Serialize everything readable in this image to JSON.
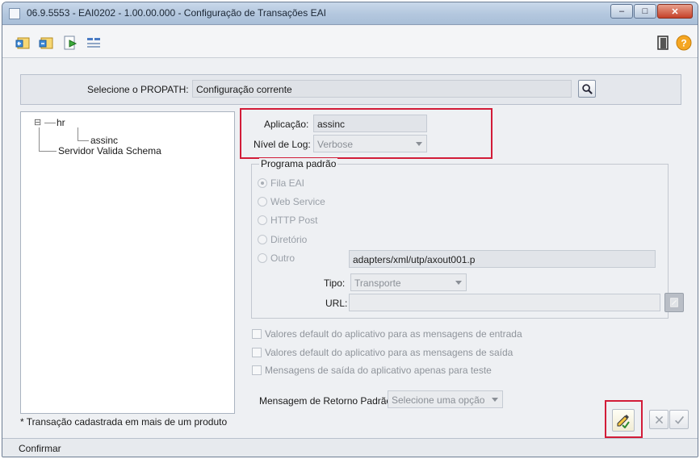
{
  "window": {
    "title": "06.9.5553 - EAI0202 - 1.00.00.000 - Configuração de Transações EAI",
    "controls": {
      "minimize": "–",
      "maximize": "□",
      "close": "✕"
    }
  },
  "toolbar": {
    "icons": [
      "first-record-icon",
      "previous-record-icon",
      "go-to-record-icon",
      "list-icon",
      "exit-door-icon",
      "help-icon"
    ]
  },
  "propath": {
    "label": "Selecione o PROPATH:",
    "value": "Configuração corrente"
  },
  "tree": {
    "nodes": [
      {
        "label": "hr",
        "expander": "⊟"
      },
      {
        "label": "assinc"
      },
      {
        "label": "Servidor Valida Schema"
      }
    ]
  },
  "form": {
    "aplicacao_label": "Aplicação:",
    "aplicacao_value": "assinc",
    "nivel_log_label": "Nível de Log:",
    "nivel_log_value": "Verbose",
    "programa_group_title": "Programa padrão",
    "radios": [
      {
        "label": "Fila EAI",
        "checked": true
      },
      {
        "label": "Web Service",
        "checked": false
      },
      {
        "label": "HTTP Post",
        "checked": false
      },
      {
        "label": "Diretório",
        "checked": false
      },
      {
        "label": "Outro",
        "checked": false
      }
    ],
    "outro_value": "adapters/xml/utp/axout001.p",
    "tipo_label": "Tipo:",
    "tipo_value": "Transporte",
    "url_label": "URL:",
    "url_value": "",
    "checkboxes": [
      "Valores default do aplicativo para as mensagens de entrada",
      "Valores default do aplicativo para as mensagens de saída",
      "Mensagens de saída do aplicativo apenas para teste"
    ],
    "retorno_label": "Mensagem de Retorno Padrão:",
    "retorno_value": "Selecione uma opção"
  },
  "footnote": "* Transação cadastrada em mais de um produto",
  "status": "Confirmar",
  "colors": {
    "highlight": "#d21c38",
    "titlebar": "#b3c7de"
  }
}
